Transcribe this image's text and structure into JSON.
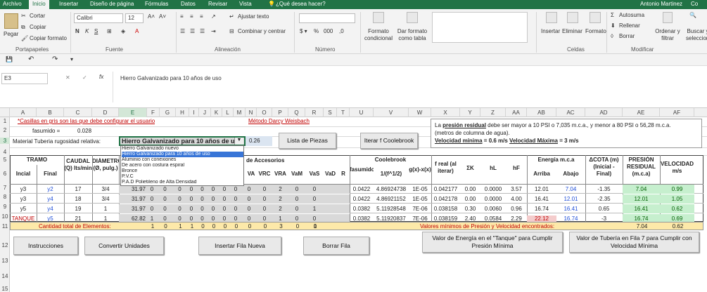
{
  "tabs": [
    "Archivo",
    "Inicio",
    "Insertar",
    "Diseño de página",
    "Fórmulas",
    "Datos",
    "Revisar",
    "Vista"
  ],
  "tell_me": "¿Qué desea hacer?",
  "user": "Antonio Martinez",
  "share": "Co",
  "ribbon": {
    "paste": "Pegar",
    "cut": "Cortar",
    "copy": "Copiar",
    "format_painter": "Copiar formato",
    "font_name": "Calibri",
    "font_size": "12",
    "wrap": "Ajustar texto",
    "merge": "Combinar y centrar",
    "number_format": "",
    "cond_format": "Formato condicional",
    "table_format": "Dar formato como tabla",
    "insert": "Insertar",
    "delete": "Eliminar",
    "format": "Formato",
    "autosum": "Autosuma",
    "fill": "Rellenar",
    "clear": "Borrar",
    "sort": "Ordenar y filtrar",
    "find": "Buscar y seleccionar",
    "groups": [
      "Portapapeles",
      "Fuente",
      "Alineación",
      "Número",
      "Celdas",
      "Modificar"
    ]
  },
  "namebox": "E3",
  "formula": "Hierro Galvanizado para 10 años de uso",
  "columns": [
    "A",
    "B",
    "C",
    "D",
    "E",
    "F",
    "G",
    "H",
    "I",
    "J",
    "K",
    "L",
    "M",
    "N",
    "O",
    "P",
    "Q",
    "R",
    "S",
    "T",
    "U",
    "V",
    "W",
    "X",
    "Y",
    "Z",
    "AA",
    "AB",
    "AC",
    "AD",
    "AE",
    "AF"
  ],
  "rows": [
    "1",
    "2",
    "3",
    "4",
    "5",
    "6",
    "7",
    "8",
    "9",
    "10",
    "11",
    "12",
    "13",
    "14",
    "15"
  ],
  "sheet": {
    "note": "*Casillas en gris son las que debe configurar el usuario",
    "method": "Método Darcy Weisbach",
    "fasumido_label": "fasumido =",
    "fasumido_val": "0.028",
    "material_label": "Material Tuberia rugosidad relativa:",
    "material_value": "Hierro Galvanizado para 10 años de uso",
    "roughness": "0.26",
    "btn_pieces": "Lista de Piezas",
    "btn_coolebrook": "Iterar f Coolebrook",
    "info_l1a": "La ",
    "info_l1b": "presión residual",
    "info_l1c": " debe ser mayor a 10 PSI o 7,035 m.c.a., y menor a 80 PSI o 56,28 m.c.a.",
    "info_l2": "(metros de columna de agua).",
    "info_l3a": "Velocidad mínima",
    "info_l3b": " = 0.6 m/s   ",
    "info_l3c": "Velocidad Máxima",
    "info_l3d": " = 3 m/s",
    "dropdown": [
      "Hierro Galvanizado nuevo",
      "Hierro Galvanizado para 10 años de uso",
      "Aluminio con conexiones",
      "De acero con costura espiral",
      "Bronce",
      "P.V.C",
      "P.A.D Polietileno de Alta Densidad"
    ],
    "h_tramo": "TRAMO",
    "h_incial": "Incial",
    "h_final": "Final",
    "h_caudal": "CAUDAL (Q) lts/min",
    "h_diam": "DIÁMETRO (Ø, pulg.)",
    "h_accesorios": "de Accesorios",
    "h_acc_cols": [
      "VA",
      "VRC",
      "VRA",
      "VaM",
      "VaS",
      "VaD",
      "R"
    ],
    "h_coolebrook": "Coolebrook",
    "h_fasumido": "fasumido",
    "h_formula": "1/(f^1/2)",
    "h_gx": "g(x)-x(x)",
    "h_freal": "f real (al iterar)",
    "h_sk": "ΣK",
    "h_hl": "hL",
    "h_hf": "hF",
    "h_energia": "Energía m.c.a",
    "h_arriba": "Arriba",
    "h_abajo": "Abajo",
    "h_cota": "ΔCOTA (m) (Inicial - Final)",
    "h_presion": "PRESIÓN RESIDUAL (m.c.a)",
    "h_vel": "VELOCIDAD m/s",
    "data_rows": [
      {
        "ini": "y3",
        "fin": "y2",
        "q": "17",
        "d": "3/4",
        "e": "31.97",
        "acc": [
          "0",
          "0",
          "0",
          "0",
          "0",
          "0",
          "0",
          "0",
          "0",
          "0",
          "2",
          "0",
          "0"
        ],
        "fas": "0.0422",
        "f1": "4.86924738",
        "gx": "1E-05",
        "fr": "0.042177",
        "sk": "0.00",
        "hl": "0.0000",
        "hf": "3.57",
        "arr": "12.01",
        "ab": "7.04",
        "cota": "-1.35",
        "pres": "7.04",
        "vel": "0.99"
      },
      {
        "ini": "y3",
        "fin": "y4",
        "q": "18",
        "d": "3/4",
        "e": "31.97",
        "acc": [
          "0",
          "0",
          "0",
          "0",
          "0",
          "0",
          "0",
          "0",
          "0",
          "0",
          "2",
          "0",
          "0"
        ],
        "fas": "0.0422",
        "f1": "4.86921152",
        "gx": "1E-05",
        "fr": "0.042178",
        "sk": "0.00",
        "hl": "0.0000",
        "hf": "4.00",
        "arr": "16.41",
        "ab": "12.01",
        "cota": "-2.35",
        "pres": "12.01",
        "vel": "1.05"
      },
      {
        "ini": "y5",
        "fin": "y4",
        "q": "19",
        "d": "1",
        "e": "31.97",
        "acc": [
          "0",
          "0",
          "0",
          "0",
          "0",
          "0",
          "0",
          "0",
          "0",
          "0",
          "2",
          "0",
          "1"
        ],
        "fas": "0.0382",
        "f1": "5.11928548",
        "gx": "7E-06",
        "fr": "0.038158",
        "sk": "0.30",
        "hl": "0.0060",
        "hf": "0.96",
        "arr": "16.74",
        "ab": "16.41",
        "cota": "0.65",
        "pres": "16.41",
        "vel": "0.62"
      },
      {
        "ini": "TANQUE",
        "fin": "y5",
        "q": "21",
        "d": "1",
        "e": "62.82",
        "acc": [
          "1",
          "0",
          "0",
          "0",
          "0",
          "0",
          "0",
          "0",
          "0",
          "0",
          "1",
          "0",
          "0"
        ],
        "fas": "0.0382",
        "f1": "5.11920837",
        "gx": "7E-06",
        "fr": "0.038159",
        "sk": "2.40",
        "hl": "0.0584",
        "hf": "2.29",
        "arr": "22.12",
        "ab": "16.74",
        "cota": "-3",
        "pres": "16.74",
        "vel": "0.69"
      }
    ],
    "total_label": "Cantidad total de Elementos:",
    "totals": [
      "1",
      "0",
      "1",
      "1",
      "0",
      "0",
      "0",
      "0",
      "0",
      "0",
      "3",
      "0",
      "0",
      "1"
    ],
    "min_label": "Valores mínimos de Presión y Velocidad encontrados:",
    "min_pres": "7.04",
    "min_vel": "0.62",
    "btn_instr": "Instrucciones",
    "btn_convert": "Convertir Unidades",
    "btn_insert": "Insertar Fila Nueva",
    "btn_delete": "Borrar Fila",
    "btn_energy": "Valor de Energía en el \"Tanque\" para Cumplir Presión Mínima",
    "btn_row7": "Valor de Tubería en Fila 7 para Cumplir con Velocidad Mínima"
  },
  "colors": {
    "excel_green": "#217346",
    "ok_green": "#c6efce",
    "red": "#c00000",
    "blue": "#1f4ed8",
    "grey_cell": "#d9d9d9",
    "yellow": "#fde9a9"
  }
}
